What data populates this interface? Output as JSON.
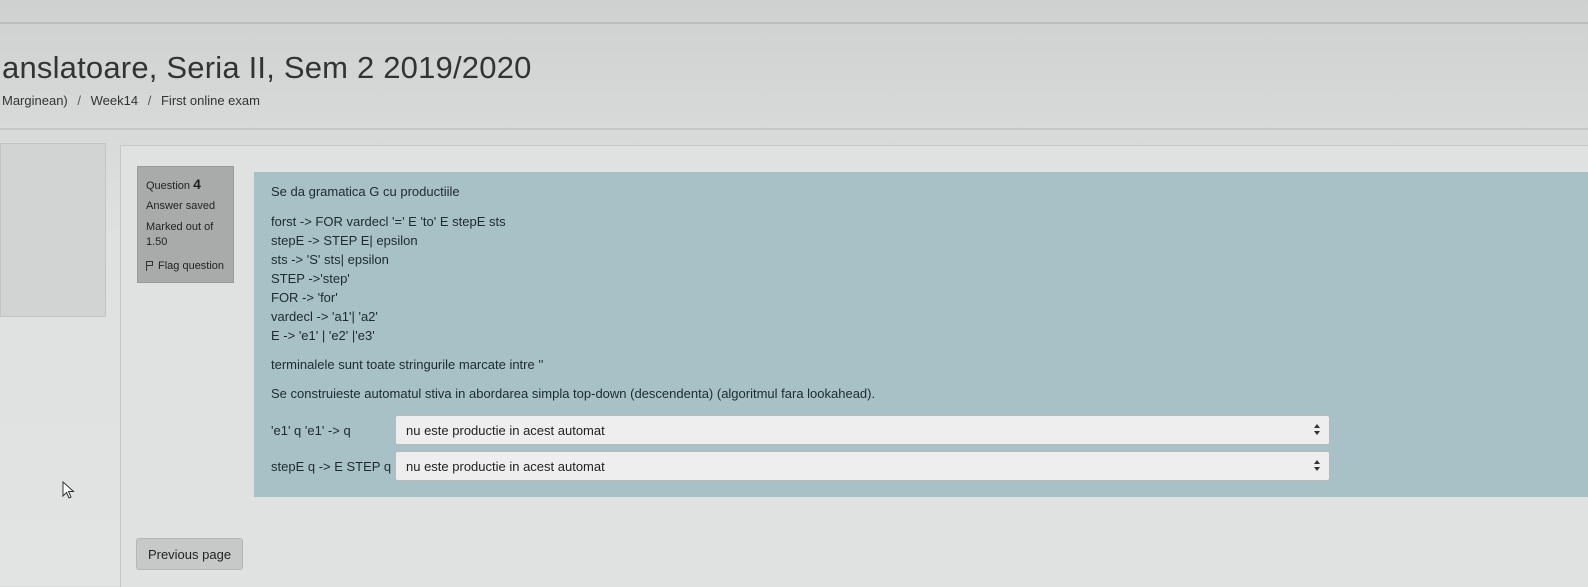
{
  "header": {
    "title": "anslatoare, Seria II, Sem 2 2019/2020",
    "breadcrumb": [
      {
        "label": "Marginean)"
      },
      {
        "label": "Week14"
      },
      {
        "label": "First online exam"
      }
    ],
    "separator": "/"
  },
  "question_info": {
    "question_label": "Question",
    "question_number": "4",
    "state": "Answer saved",
    "grade_line1": "Marked out of",
    "grade_line2": "1.50",
    "flag_label": "Flag question",
    "flag_icon": "flag-icon"
  },
  "question": {
    "text": "Se da gramatica G cu productiile",
    "productions": [
      "forst -> FOR vardecl '=' E 'to' E stepE sts",
      "stepE -> STEP E| epsilon",
      "sts -> 'S' sts| epsilon",
      "STEP ->'step'",
      "FOR -> 'for'",
      "vardecl -> 'a1'| 'a2'",
      "E -> 'e1' | 'e2' |'e3'"
    ],
    "terminals_note": "terminalele sunt toate stringurile marcate intre ''",
    "instruction": "Se construieste automatul stiva in abordarea simpla top-down (descendenta) (algoritmul fara lookahead).",
    "matches": [
      {
        "label": "'e1' q 'e1' -> q",
        "selected": "nu este productie in acest automat"
      },
      {
        "label": "stepE q -> E STEP q",
        "selected": "nu este productie in acest automat"
      }
    ]
  },
  "navigation": {
    "previous_label": "Previous page"
  },
  "colors": {
    "formulation_bg": "#a7c1c7",
    "info_bg": "#a9abab"
  }
}
